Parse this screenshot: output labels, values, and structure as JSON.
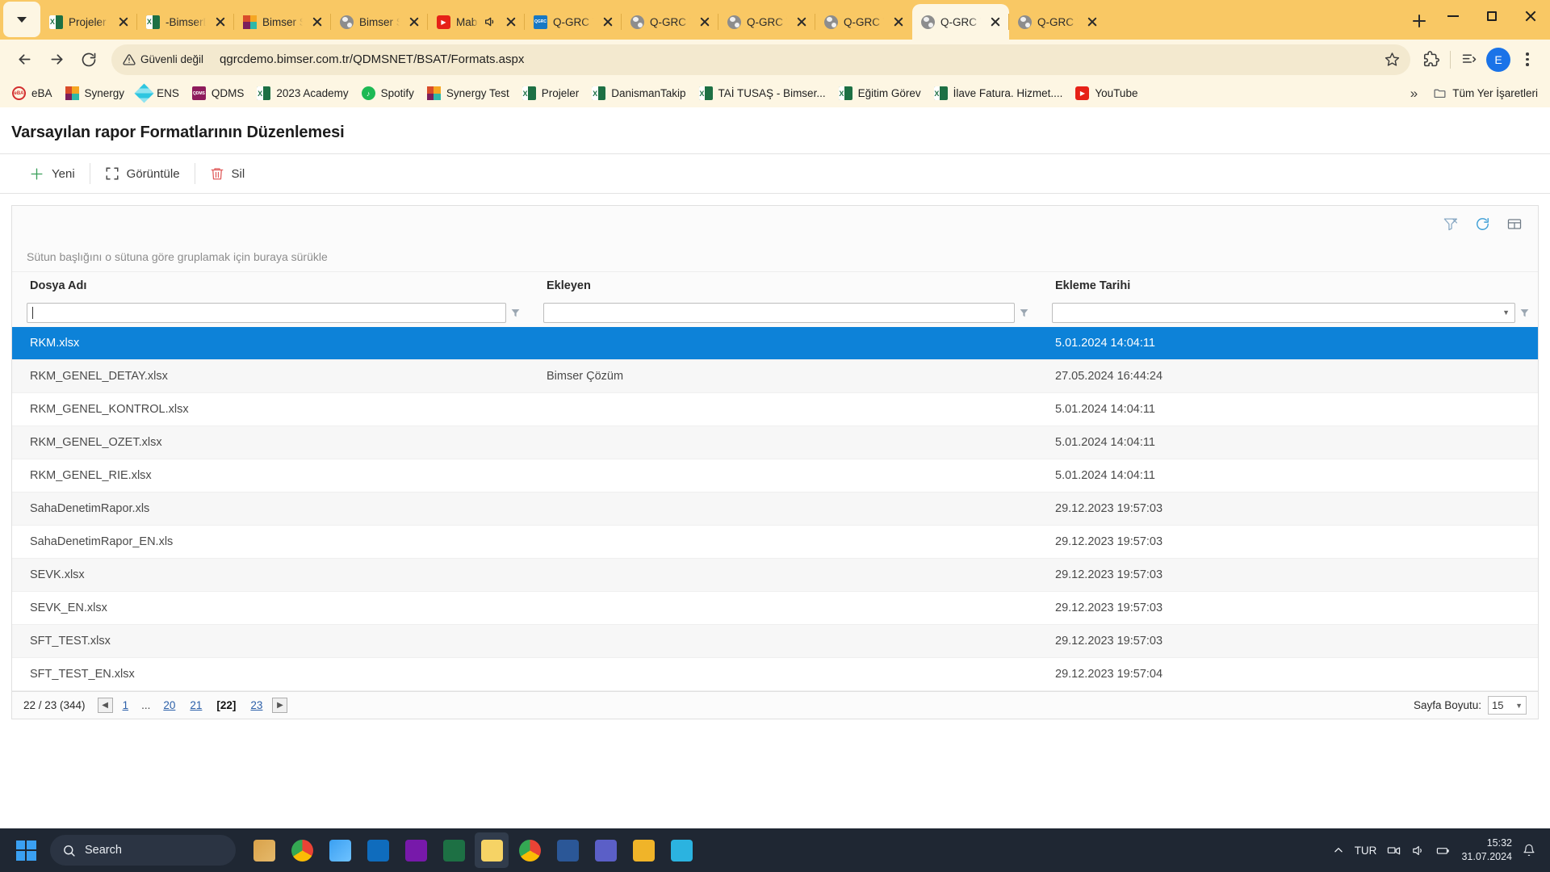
{
  "browser": {
    "tab_list_icon": "chevron-down-icon",
    "tabs": [
      {
        "title": "Projeler A...",
        "favicon": "excel-icon",
        "active": false,
        "audio": false
      },
      {
        "title": "-BimserD...",
        "favicon": "excel-icon",
        "active": false,
        "audio": false
      },
      {
        "title": "Bimser S...",
        "favicon": "synergy-icon",
        "active": false,
        "audio": false
      },
      {
        "title": "Bimser S...",
        "favicon": "globe-icon",
        "active": false,
        "audio": false
      },
      {
        "title": "Mab...",
        "favicon": "youtube-icon",
        "active": false,
        "audio": true
      },
      {
        "title": "Q-GRC Y...",
        "favicon": "qgrc-icon",
        "active": false,
        "audio": false
      },
      {
        "title": "Q-GRC Y...",
        "favicon": "globe-icon",
        "active": false,
        "audio": false
      },
      {
        "title": "Q-GRC Y...",
        "favicon": "globe-icon",
        "active": false,
        "audio": false
      },
      {
        "title": "Q-GRC Y...",
        "favicon": "globe-icon",
        "active": false,
        "audio": false
      },
      {
        "title": "Q-GRC Y...",
        "favicon": "globe-icon",
        "active": true,
        "audio": false
      },
      {
        "title": "Q-GRC Y...",
        "favicon": "globe-icon",
        "active": false,
        "audio": false
      }
    ],
    "new_tab_label": "+",
    "window_controls": {
      "minimize": "minimize-icon",
      "maximize": "maximize-icon",
      "close": "close-icon"
    },
    "nav": {
      "back": "back-arrow-icon",
      "forward": "forward-arrow-icon",
      "reload": "reload-icon"
    },
    "omnibox": {
      "security_warning": "Güvenli değil",
      "security_icon": "warning-triangle-icon",
      "url": "qgrcdemo.bimser.com.tr/QDMSNET/BSAT/Formats.aspx",
      "bookmark_icon": "star-icon"
    },
    "toolbar_icons": [
      "extensions-icon",
      "reading-list-icon"
    ],
    "profile_initial": "E",
    "menu_icon": "kebab-menu-icon",
    "bookmarks": [
      {
        "label": "eBA",
        "favicon": "eba-icon"
      },
      {
        "label": "Synergy",
        "favicon": "synergy-icon"
      },
      {
        "label": "ENS",
        "favicon": "ens-icon"
      },
      {
        "label": "QDMS",
        "favicon": "qdms-icon"
      },
      {
        "label": "2023 Academy",
        "favicon": "excel-icon"
      },
      {
        "label": "Spotify",
        "favicon": "spotify-icon"
      },
      {
        "label": "Synergy Test",
        "favicon": "synergy-icon"
      },
      {
        "label": "Projeler",
        "favicon": "excel-icon"
      },
      {
        "label": "DanismanTakip",
        "favicon": "excel-icon"
      },
      {
        "label": "TAİ TUSAŞ - Bimser...",
        "favicon": "excel-icon"
      },
      {
        "label": "Eğitim Görev",
        "favicon": "excel-icon"
      },
      {
        "label": "İlave Fatura. Hizmet....",
        "favicon": "excel-icon"
      },
      {
        "label": "YouTube",
        "favicon": "youtube-icon"
      }
    ],
    "bookmarks_overflow_icon": "chevron-right-double-icon",
    "all_bookmarks_label": "Tüm Yer İşaretleri",
    "all_bookmarks_icon": "folder-icon"
  },
  "page": {
    "title": "Varsayılan rapor Formatlarının Düzenlemesi",
    "commands": [
      {
        "label": "Yeni",
        "icon": "plus-icon"
      },
      {
        "label": "Görüntüle",
        "icon": "view-frame-icon"
      },
      {
        "label": "Sil",
        "icon": "trash-icon"
      }
    ],
    "grid_toolbar_icons": [
      "clear-filter-icon",
      "refresh-icon",
      "column-chooser-icon"
    ],
    "group_hint": "Sütun başlığını o sütuna göre gruplamak için buraya sürükle",
    "columns": [
      {
        "key": "dosya_adi",
        "label": "Dosya Adı",
        "filter_value": "",
        "filter_icon": "funnel-icon"
      },
      {
        "key": "ekleyen",
        "label": "Ekleyen",
        "filter_value": "",
        "filter_icon": "funnel-icon"
      },
      {
        "key": "ekleme_tarihi",
        "label": "Ekleme Tarihi",
        "filter_value": "",
        "filter_icon": "funnel-icon"
      }
    ],
    "rows": [
      {
        "dosya_adi": "RKM.xlsx",
        "ekleyen": "",
        "ekleme_tarihi": "5.01.2024 14:04:11",
        "selected": true
      },
      {
        "dosya_adi": "RKM_GENEL_DETAY.xlsx",
        "ekleyen": "Bimser Çözüm",
        "ekleme_tarihi": "27.05.2024 16:44:24",
        "selected": false
      },
      {
        "dosya_adi": "RKM_GENEL_KONTROL.xlsx",
        "ekleyen": "",
        "ekleme_tarihi": "5.01.2024 14:04:11",
        "selected": false
      },
      {
        "dosya_adi": "RKM_GENEL_OZET.xlsx",
        "ekleyen": "",
        "ekleme_tarihi": "5.01.2024 14:04:11",
        "selected": false
      },
      {
        "dosya_adi": "RKM_GENEL_RIE.xlsx",
        "ekleyen": "",
        "ekleme_tarihi": "5.01.2024 14:04:11",
        "selected": false
      },
      {
        "dosya_adi": "SahaDenetimRapor.xls",
        "ekleyen": "",
        "ekleme_tarihi": "29.12.2023 19:57:03",
        "selected": false
      },
      {
        "dosya_adi": "SahaDenetimRapor_EN.xls",
        "ekleyen": "",
        "ekleme_tarihi": "29.12.2023 19:57:03",
        "selected": false
      },
      {
        "dosya_adi": "SEVK.xlsx",
        "ekleyen": "",
        "ekleme_tarihi": "29.12.2023 19:57:03",
        "selected": false
      },
      {
        "dosya_adi": "SEVK_EN.xlsx",
        "ekleyen": "",
        "ekleme_tarihi": "29.12.2023 19:57:03",
        "selected": false
      },
      {
        "dosya_adi": "SFT_TEST.xlsx",
        "ekleyen": "",
        "ekleme_tarihi": "29.12.2023 19:57:03",
        "selected": false
      },
      {
        "dosya_adi": "SFT_TEST_EN.xlsx",
        "ekleyen": "",
        "ekleme_tarihi": "29.12.2023 19:57:04",
        "selected": false
      }
    ],
    "pager": {
      "summary": "22 / 23 (344)",
      "prev_icon": "chevron-left-icon",
      "next_icon": "chevron-right-icon",
      "pages": [
        "1",
        "...",
        "20",
        "21",
        "[22]",
        "23"
      ],
      "current_page": "[22]",
      "page_size_label": "Sayfa Boyutu:",
      "page_size_value": "15"
    }
  },
  "taskbar": {
    "start_icon": "windows-logo-icon",
    "search_placeholder": "Search",
    "search_icon": "search-icon",
    "apps": [
      {
        "name": "copilot-icon"
      },
      {
        "name": "chrome-icon"
      },
      {
        "name": "task-view-icon"
      },
      {
        "name": "outlook-icon"
      },
      {
        "name": "onenote-icon"
      },
      {
        "name": "excel-icon"
      },
      {
        "name": "sticky-notes-icon"
      },
      {
        "name": "google-chrome-icon"
      },
      {
        "name": "word-icon"
      },
      {
        "name": "teams-icon"
      },
      {
        "name": "file-explorer-icon"
      },
      {
        "name": "security-icon"
      }
    ],
    "tray": {
      "overflow_icon": "chevron-up-icon",
      "language": "TUR",
      "network_icon": "network-icon",
      "volume_icon": "volume-icon",
      "battery_icon": "battery-icon",
      "time": "15:32",
      "date": "31.07.2024",
      "notification_icon": "bell-icon"
    }
  }
}
